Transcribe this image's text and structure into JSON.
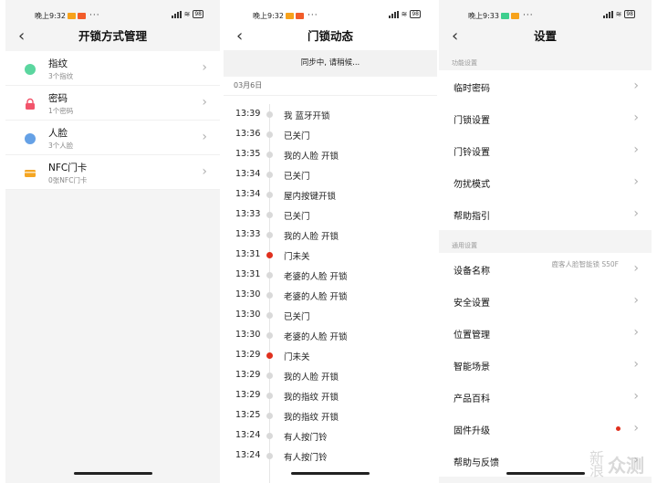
{
  "status": {
    "screen1_time": "晚上9:32",
    "screen2_time": "晚上9:32",
    "screen3_time": "晚上9:33",
    "battery": "98"
  },
  "unlock_screen": {
    "title": "开锁方式管理",
    "items": [
      {
        "label": "指纹",
        "sub": "3个指纹",
        "icon": "fingerprint-icon",
        "color": "#3ecf8e"
      },
      {
        "label": "密码",
        "sub": "1个密码",
        "icon": "lock-icon",
        "color": "#f2546b"
      },
      {
        "label": "人脸",
        "sub": "3个人脸",
        "icon": "face-icon",
        "color": "#4a90e2"
      },
      {
        "label": "NFC门卡",
        "sub": "0张NFC门卡",
        "icon": "card-icon",
        "color": "#f5a623"
      }
    ]
  },
  "log_screen": {
    "title": "门锁动态",
    "sync": "同步中, 请稍候...",
    "date": "03月6日",
    "events": [
      {
        "time": "13:39",
        "text": "我 蓝牙开锁",
        "alert": false
      },
      {
        "time": "13:36",
        "text": "已关门",
        "alert": false
      },
      {
        "time": "13:35",
        "text": "我的人脸 开锁",
        "alert": false
      },
      {
        "time": "13:34",
        "text": "已关门",
        "alert": false
      },
      {
        "time": "13:34",
        "text": "屋内按键开锁",
        "alert": false
      },
      {
        "time": "13:33",
        "text": "已关门",
        "alert": false
      },
      {
        "time": "13:33",
        "text": "我的人脸 开锁",
        "alert": false
      },
      {
        "time": "13:31",
        "text": "门未关",
        "alert": true
      },
      {
        "time": "13:31",
        "text": "老婆的人脸 开锁",
        "alert": false
      },
      {
        "time": "13:30",
        "text": "老婆的人脸 开锁",
        "alert": false
      },
      {
        "time": "13:30",
        "text": "已关门",
        "alert": false
      },
      {
        "time": "13:30",
        "text": "老婆的人脸 开锁",
        "alert": false
      },
      {
        "time": "13:29",
        "text": "门未关",
        "alert": true
      },
      {
        "time": "13:29",
        "text": "我的人脸 开锁",
        "alert": false
      },
      {
        "time": "13:29",
        "text": "我的指纹 开锁",
        "alert": false
      },
      {
        "time": "13:25",
        "text": "我的指纹 开锁",
        "alert": false
      },
      {
        "time": "13:24",
        "text": "有人按门铃",
        "alert": false
      },
      {
        "time": "13:24",
        "text": "有人按门铃",
        "alert": false
      }
    ]
  },
  "settings_screen": {
    "title": "设置",
    "section1": "功能设置",
    "function_items": [
      "临时密码",
      "门锁设置",
      "门铃设置",
      "勿扰模式",
      "帮助指引"
    ],
    "section2": "通用设置",
    "general_items": [
      {
        "label": "设备名称",
        "value": "鹿客人脸智能锁 S50F"
      },
      {
        "label": "安全设置"
      },
      {
        "label": "位置管理"
      },
      {
        "label": "智能场景"
      },
      {
        "label": "产品百科"
      },
      {
        "label": "固件升级",
        "badge": true
      },
      {
        "label": "帮助与反馈"
      }
    ]
  },
  "watermark": {
    "line1": "新",
    "line2": "浪",
    "text": "众测"
  }
}
